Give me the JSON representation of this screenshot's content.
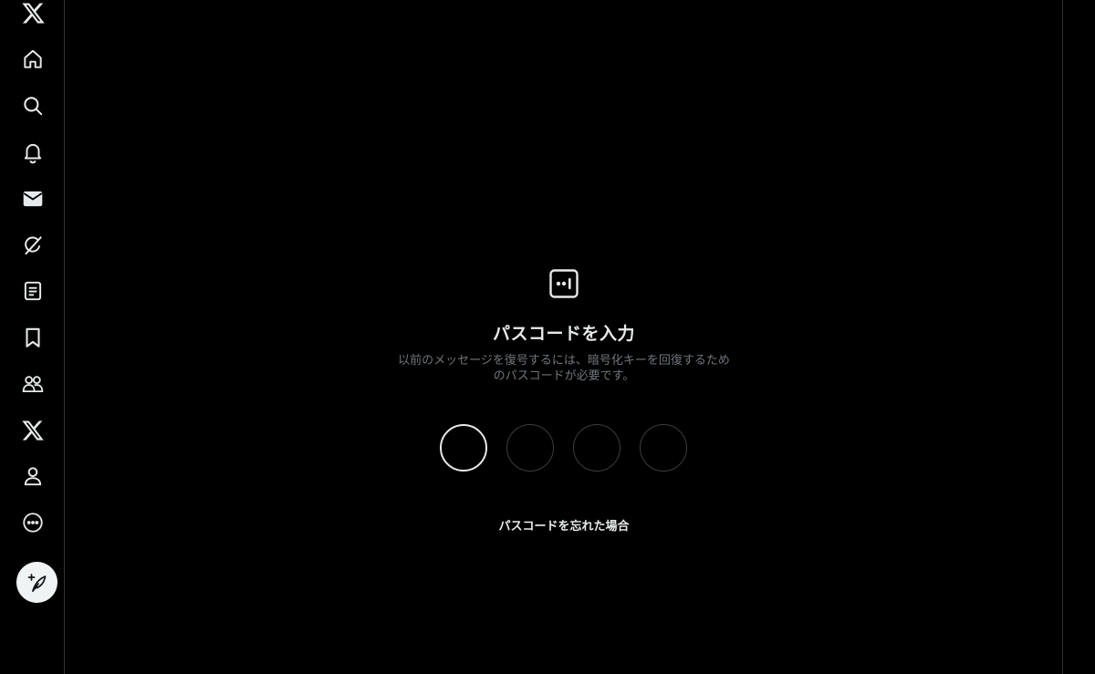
{
  "sidebar": {
    "items": [
      {
        "name": "x-logo",
        "icon": "x-logo-icon"
      },
      {
        "name": "home",
        "icon": "home-icon"
      },
      {
        "name": "explore",
        "icon": "search-icon"
      },
      {
        "name": "notifications",
        "icon": "bell-icon"
      },
      {
        "name": "messages",
        "icon": "envelope-icon"
      },
      {
        "name": "grok",
        "icon": "grok-icon"
      },
      {
        "name": "lists",
        "icon": "list-icon"
      },
      {
        "name": "bookmarks",
        "icon": "bookmark-icon"
      },
      {
        "name": "communities",
        "icon": "communities-icon"
      },
      {
        "name": "premium",
        "icon": "x-icon"
      },
      {
        "name": "profile",
        "icon": "person-icon"
      },
      {
        "name": "more",
        "icon": "more-circle-icon"
      }
    ],
    "post_button_icon": "compose-feather-icon"
  },
  "passcode": {
    "icon": "lock-passcode-icon",
    "title": "パスコードを入力",
    "description": "以前のメッセージを復号するには、暗号化キーを回復するためのパスコードが必要です。",
    "digits": 4,
    "active_index": 0,
    "forgot_label": "パスコードを忘れた場合"
  },
  "colors": {
    "background": "#000000",
    "text_primary": "#e7e9ea",
    "text_secondary": "#71767b",
    "border": "#2f3336",
    "post_button_bg": "#eff3f4"
  }
}
